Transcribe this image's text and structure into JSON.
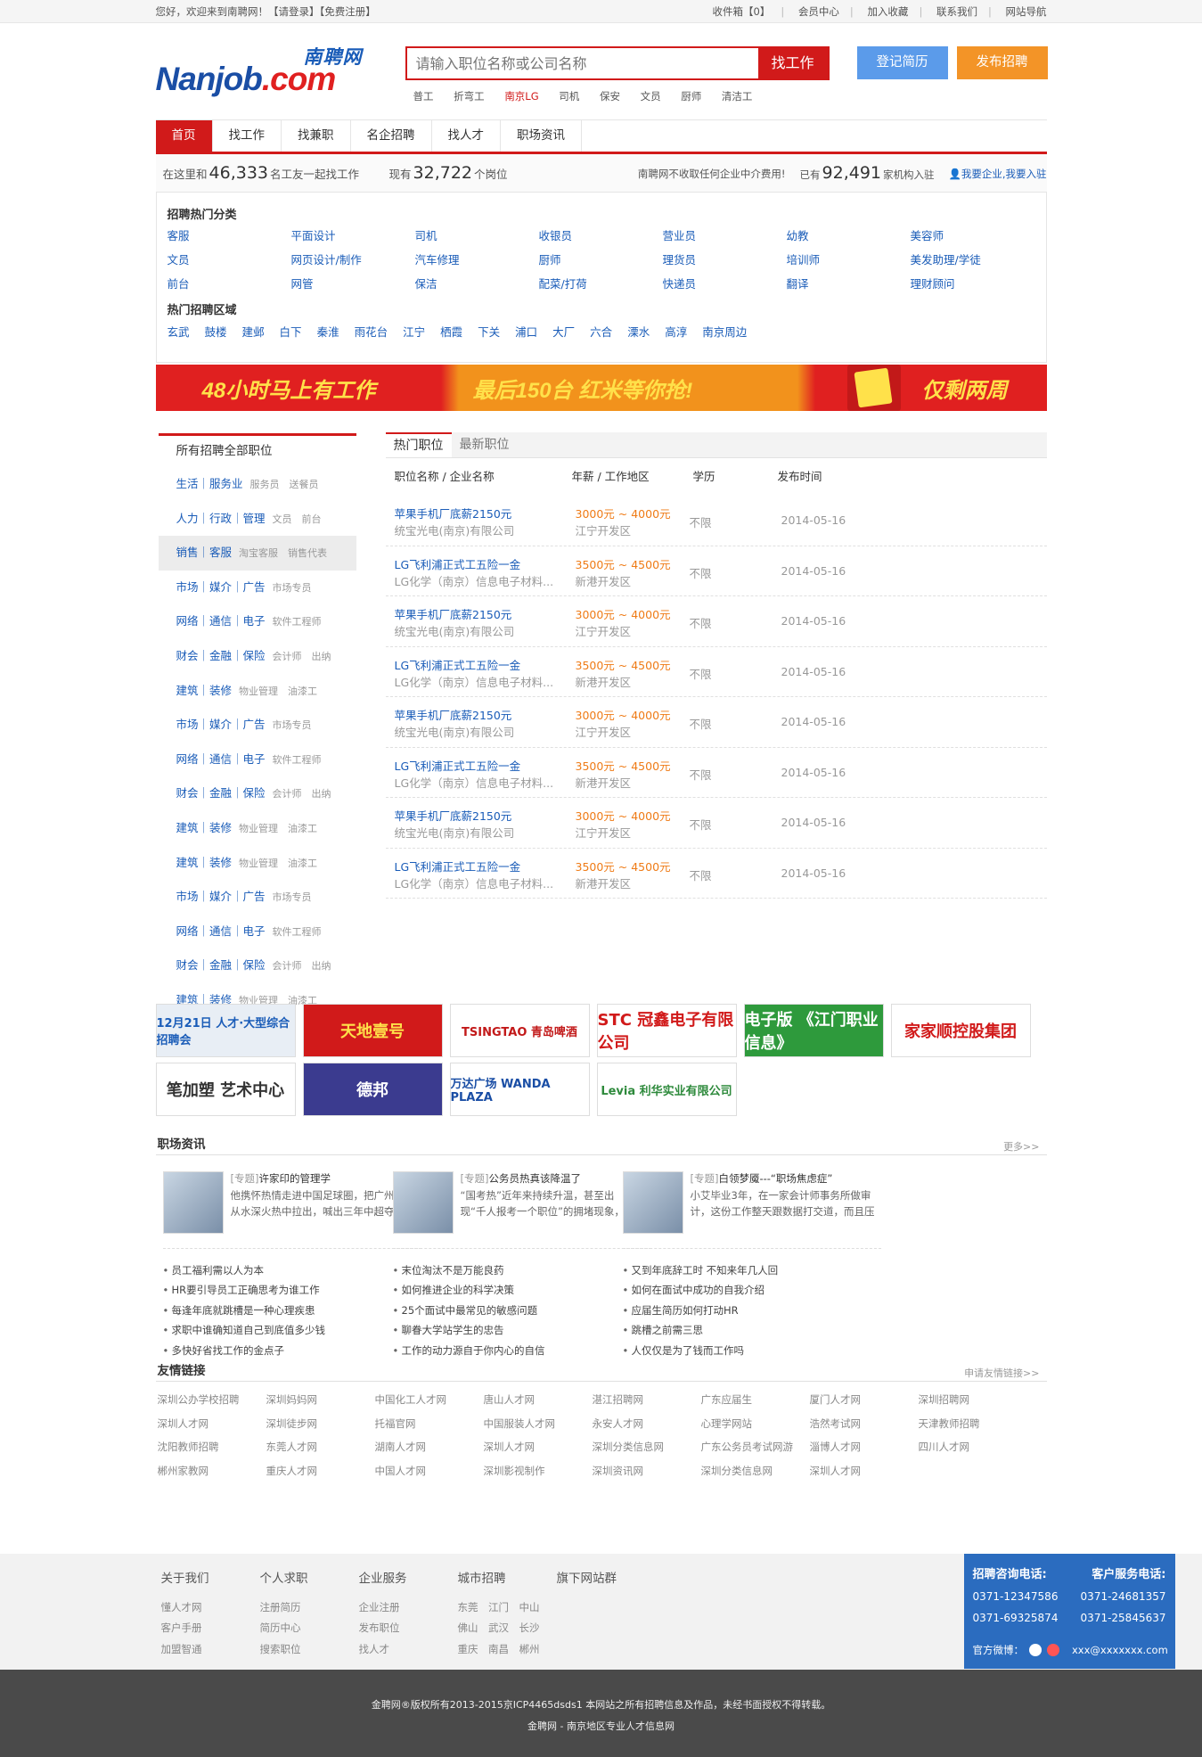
{
  "topbar": {
    "welcome": "您好，欢迎来到南聘网！【请登录】【免费注册】",
    "inbox": "收件箱【0】",
    "member": "会员中心",
    "fav": "加入收藏",
    "contact": "联系我们",
    "sitenav": "网站导航"
  },
  "logo": {
    "cn": "南聘网",
    "en_a": "Nanjob",
    "en_b": ".com"
  },
  "search": {
    "placeholder": "请输入职位名称或公司名称",
    "button": "找工作",
    "hot": [
      "普工",
      "折弯工",
      "南京LG",
      "司机",
      "保安",
      "文员",
      "厨师",
      "清洁工"
    ]
  },
  "buttons": {
    "resume": "登记简历",
    "post": "发布招聘"
  },
  "nav": [
    "首页",
    "找工作",
    "找兼职",
    "名企招聘",
    "找人才",
    "职场资讯"
  ],
  "stats": {
    "a1": "在这里和",
    "n1": "46,333",
    "a2": "名工友一起找工作",
    "b1": "现有",
    "n2": "32,722",
    "b2": "个岗位",
    "c": "南聘网不收取任何企业中介费用!",
    "d1": "已有",
    "n3": "92,491",
    "d2": "家机构入驻",
    "e": "我要企业,我要入驻"
  },
  "categories": {
    "title": "招聘热门分类",
    "items": [
      "客服",
      "平面设计",
      "司机",
      "收银员",
      "营业员",
      "幼教",
      "美容师",
      "文员",
      "网页设计/制作",
      "汽车修理",
      "厨师",
      "理货员",
      "培训师",
      "美发助理/学徒",
      "前台",
      "网管",
      "保洁",
      "配菜/打荷",
      "快递员",
      "翻译",
      "理财顾问"
    ],
    "area_title": "热门招聘区域",
    "areas": [
      "玄武",
      "鼓楼",
      "建邺",
      "白下",
      "秦淮",
      "雨花台",
      "江宁",
      "栖霞",
      "下关",
      "浦口",
      "大厂",
      "六合",
      "溧水",
      "高淳",
      "南京周边"
    ]
  },
  "banner": {
    "t1": "48小时马上有工作",
    "t2": "最后150台 红米等你抢!",
    "t3": "仅剩两周"
  },
  "side": {
    "title": "所有招聘全部职位",
    "rows": [
      {
        "m": "生活｜服务业",
        "s": "服务员　送餐员"
      },
      {
        "m": "人力｜行政｜管理",
        "s": "文员　前台"
      },
      {
        "m": "销售｜客服",
        "s": "淘宝客服　销售代表"
      },
      {
        "m": "市场｜媒介｜广告",
        "s": "市场专员"
      },
      {
        "m": "网络｜通信｜电子",
        "s": "软件工程师"
      },
      {
        "m": "财会｜金融｜保险",
        "s": "会计师　出纳"
      },
      {
        "m": "建筑｜装修",
        "s": "物业管理　油漆工"
      },
      {
        "m": "市场｜媒介｜广告",
        "s": "市场专员"
      },
      {
        "m": "网络｜通信｜电子",
        "s": "软件工程师"
      },
      {
        "m": "财会｜金融｜保险",
        "s": "会计师　出纳"
      },
      {
        "m": "建筑｜装修",
        "s": "物业管理　油漆工"
      },
      {
        "m": "建筑｜装修",
        "s": "物业管理　油漆工"
      },
      {
        "m": "市场｜媒介｜广告",
        "s": "市场专员"
      },
      {
        "m": "网络｜通信｜电子",
        "s": "软件工程师"
      },
      {
        "m": "财会｜金融｜保险",
        "s": "会计师　出纳"
      },
      {
        "m": "建筑｜装修",
        "s": "物业管理　油漆工"
      }
    ]
  },
  "jobs": {
    "tabs": [
      "热门职位",
      "最新职位"
    ],
    "head": [
      "职位名称 / 企业名称",
      "年薪 / 工作地区",
      "学历",
      "发布时间"
    ],
    "rows": [
      {
        "t": "苹果手机厂底薪2150元",
        "c": "统宝光电(南京)有限公司",
        "p": "3000元 ~ 4000元",
        "a": "江宁开发区",
        "e": "不限",
        "d": "2014-05-16"
      },
      {
        "t": "LG飞利浦正式工五险一金",
        "c": "LG化学（南京）信息电子材料...",
        "p": "3500元 ~ 4500元",
        "a": "新港开发区",
        "e": "不限",
        "d": "2014-05-16"
      },
      {
        "t": "苹果手机厂底薪2150元",
        "c": "统宝光电(南京)有限公司",
        "p": "3000元 ~ 4000元",
        "a": "江宁开发区",
        "e": "不限",
        "d": "2014-05-16"
      },
      {
        "t": "LG飞利浦正式工五险一金",
        "c": "LG化学（南京）信息电子材料...",
        "p": "3500元 ~ 4500元",
        "a": "新港开发区",
        "e": "不限",
        "d": "2014-05-16"
      },
      {
        "t": "苹果手机厂底薪2150元",
        "c": "统宝光电(南京)有限公司",
        "p": "3000元 ~ 4000元",
        "a": "江宁开发区",
        "e": "不限",
        "d": "2014-05-16"
      },
      {
        "t": "LG飞利浦正式工五险一金",
        "c": "LG化学（南京）信息电子材料...",
        "p": "3500元 ~ 4500元",
        "a": "新港开发区",
        "e": "不限",
        "d": "2014-05-16"
      },
      {
        "t": "苹果手机厂底薪2150元",
        "c": "统宝光电(南京)有限公司",
        "p": "3000元 ~ 4000元",
        "a": "江宁开发区",
        "e": "不限",
        "d": "2014-05-16"
      },
      {
        "t": "LG飞利浦正式工五险一金",
        "c": "LG化学（南京）信息电子材料...",
        "p": "3500元 ~ 4500元",
        "a": "新港开发区",
        "e": "不限",
        "d": "2014-05-16"
      }
    ]
  },
  "logos": [
    "12月21日 人才·大型综合招聘会",
    "天地壹号",
    "TSINGTAO 青岛啤酒",
    "STC 冠鑫电子有限公司",
    "电子版 《江门职业信息》",
    "家家顺控股集团",
    "笔加塑 艺术中心",
    "德邦",
    "万达广场 WANDA PLAZA",
    "Levia 利华实业有限公司"
  ],
  "news": {
    "title": "职场资讯",
    "more": "更多>>",
    "cols": [
      {
        "tag": "[专题]",
        "title": "许家印的管理学",
        "d1": "他携怀热情走进中国足球圈，把广州足球",
        "d2": "从水深火热中拉出，喊出三年中超夺冠，",
        "items": [
          "员工福利需以人为本",
          "HR要引导员工正确思考为谁工作",
          "每逢年底就跳槽是一种心理疾患",
          "求职中谁确知道自己到底值多少钱",
          "多快好省找工作的金点子"
        ]
      },
      {
        "tag": "[专题]",
        "title": "公务员热真该降温了",
        "d1": "“国考热”近年来持续升温，甚至出",
        "d2": "现“千人报考一个职位”的拥堵现象，引",
        "items": [
          "末位淘汰不是万能良药",
          "如何推进企业的科学决策",
          "25个面试中最常见的敏感问题",
          "聊眷大学站学生的忠告",
          "工作的动力源自于你内心的自信"
        ]
      },
      {
        "tag": "[专题]",
        "title": "白领梦魇---“职场焦虑症”",
        "d1": "小艾毕业3年，在一家会计师事务所做审",
        "d2": "计，这份工作整天跟数据打交道，而且压",
        "items": [
          "又到年底辞工时 不知来年几人回",
          "如何在面试中成功的自我介绍",
          "应届生简历如何打动HR",
          "跳槽之前需三思",
          "人仅仅是为了钱而工作吗"
        ]
      }
    ]
  },
  "links": {
    "title": "友情链接",
    "apply": "申请友情链接>>",
    "items": [
      "深圳公办学校招聘",
      "深圳妈妈网",
      "中国化工人才网",
      "唐山人才网",
      "湛江招聘网",
      "广东应届生",
      "厦门人才网",
      "深圳招聘网",
      "深圳人才网",
      "深圳徒步网",
      "托福官网",
      "中国服装人才网",
      "永安人才网",
      "心理学网站",
      "浩然考试网",
      "天津教师招聘",
      "沈阳教师招聘",
      "东莞人才网",
      "湖南人才网",
      "深圳人才网",
      "深圳分类信息网",
      "广东公务员考试网游",
      "淄博人才网",
      "四川人才网",
      "郴州家教网",
      "重庆人才网",
      "中国人才网",
      "深圳影视制作",
      "深圳资讯网",
      "深圳分类信息网",
      "深圳人才网"
    ]
  },
  "footer": {
    "cols": [
      {
        "h": "关于我们",
        "items": [
          "懂人才网",
          "客户手册",
          "加盟智通"
        ]
      },
      {
        "h": "个人求职",
        "items": [
          "注册简历",
          "简历中心",
          "搜索职位"
        ]
      },
      {
        "h": "企业服务",
        "items": [
          "企业注册",
          "发布职位",
          "找人才"
        ]
      },
      {
        "h": "城市招聘",
        "items": [
          "东莞　江门　中山",
          "佛山　武汉　长沙",
          "重庆　南昌　郴州"
        ]
      },
      {
        "h": "旗下网站群",
        "items": []
      }
    ],
    "hotline": {
      "h1": "招聘咨询电话:",
      "h2": "客户服务电话:",
      "p1a": "0371-12347586",
      "p1b": "0371-24681357",
      "p2a": "0371-69325874",
      "p2b": "0371-25845637",
      "weibo": "官方微博：",
      "email": "xxx@xxxxxxx.com"
    }
  },
  "copyright": {
    "l1": "金聘网®版权所有2013-2015京ICP4465dsds1 本网站之所有招聘信息及作品，未经书面授权不得转载。",
    "l2": "金聘网 - 南京地区专业人才信息网"
  }
}
